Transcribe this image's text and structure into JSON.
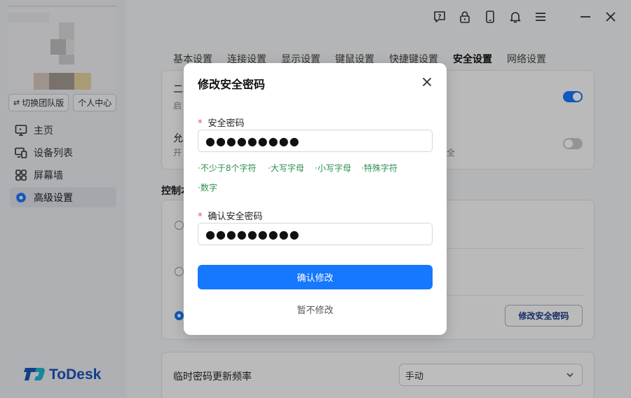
{
  "sidebar": {
    "team_button": "切换团队版",
    "personal_button": "个人中心",
    "nav": [
      {
        "label": "主页",
        "icon": "monitor-icon"
      },
      {
        "label": "设备列表",
        "icon": "devices-icon"
      },
      {
        "label": "屏幕墙",
        "icon": "grid-icon"
      },
      {
        "label": "高级设置",
        "icon": "gear-icon",
        "active": true
      }
    ],
    "logo": "ToDesk"
  },
  "tabs": [
    {
      "label": "基本设置"
    },
    {
      "label": "连接设置"
    },
    {
      "label": "显示设置"
    },
    {
      "label": "键鼠设置"
    },
    {
      "label": "快捷键设置"
    },
    {
      "label": "安全设置",
      "active": true
    },
    {
      "label": "网络设置"
    }
  ],
  "settings": {
    "row1_title": "二",
    "row1_sub": "启",
    "row2_title": "允",
    "row2_sub": "开",
    "row2_sub_tail": "全",
    "section_label": "控制本",
    "change_pwd_button": "修改安全密码",
    "temp_pwd_label": "临时密码更新频率",
    "temp_pwd_value": "手动"
  },
  "modal": {
    "title": "修改安全密码",
    "pwd_label": "安全密码",
    "pwd_value": "●●●●●●●●●",
    "hints": [
      "·不少于8个字符",
      "·大写字母",
      "·小写字母",
      "·特殊字符",
      "·数字"
    ],
    "confirm_label": "确认安全密码",
    "confirm_value": "●●●●●●●●●",
    "submit": "确认修改",
    "cancel": "暂不修改"
  },
  "colors": {
    "primary": "#1677ff",
    "hint_green": "#2f8f4f",
    "required_red": "#e34d4d",
    "logo_blue": "#1a54b8"
  }
}
